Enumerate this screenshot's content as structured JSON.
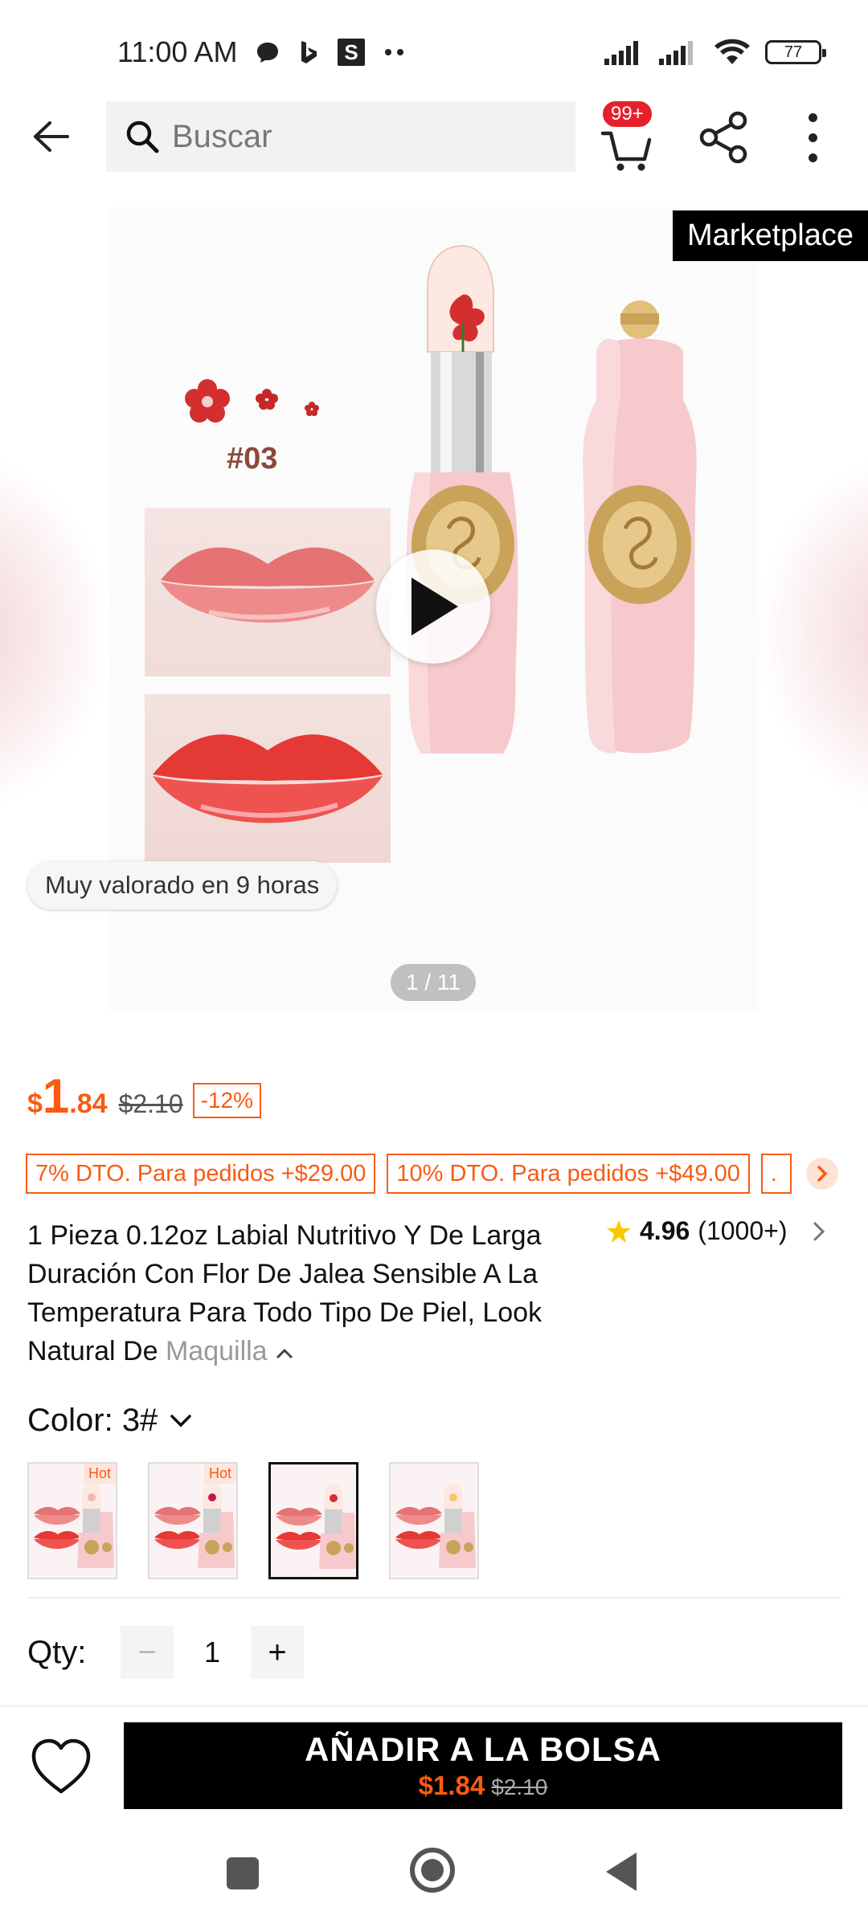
{
  "status_bar": {
    "time": "11:00 AM",
    "s_icon_text": "S",
    "battery": "77",
    "icons": [
      "chat-icon",
      "bing-icon",
      "s-app-icon",
      "more-notifications-icon",
      "signal-icon",
      "signal-icon-2",
      "wifi-icon",
      "battery-icon"
    ]
  },
  "header": {
    "search_placeholder": "Buscar",
    "cart_badge": "99+"
  },
  "gallery": {
    "marketplace_tag": "Marketplace",
    "shade_code": "#03",
    "rated_badge": "Muy valorado en 9 horas",
    "page_indicator": "1 / 11"
  },
  "price": {
    "currency": "$",
    "integer": "1",
    "decimal": ".84",
    "original": "$2.10",
    "discount": "-12%"
  },
  "promos": [
    "7% DTO. Para pedidos +$29.00",
    "10% DTO. Para pedidos +$49.00",
    "."
  ],
  "product": {
    "title_main": "1 Pieza 0.12oz Labial Nutritivo Y De Larga Duración Con Flor De Jalea Sensible A La Temperatura Para Todo Tipo De Piel, Look Natural De ",
    "title_fade": "Maquilla",
    "rating": "4.96",
    "rating_count": "(1000+)"
  },
  "color": {
    "label": "Color: 3#",
    "swatches": [
      {
        "hot": "Hot",
        "flower": "#f2b7b5"
      },
      {
        "hot": "Hot",
        "flower": "#c2185b"
      },
      {
        "hot": "",
        "flower": "#d32f2f"
      },
      {
        "hot": "",
        "flower": "#f5c96a"
      }
    ],
    "selected_index": 2
  },
  "quantity": {
    "label": "Qty:",
    "minus": "−",
    "value": "1",
    "plus": "+"
  },
  "bottom_bar": {
    "add_label": "AÑADIR A LA BOLSA",
    "price": "$1.84",
    "original": "$2.10"
  },
  "colors": {
    "accent": "#fa5a12",
    "badge_red": "#e8202c",
    "button_black": "#000000",
    "lipstick_pink": "#f6c9cc"
  }
}
